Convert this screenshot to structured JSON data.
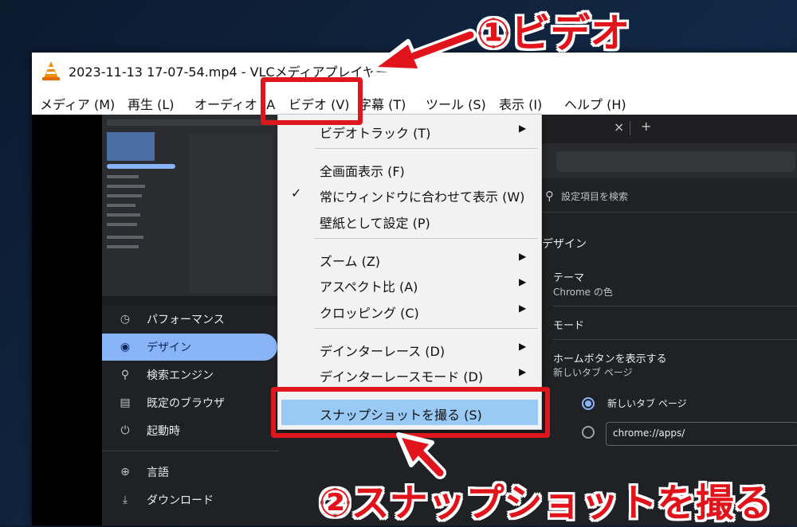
{
  "window": {
    "title": "2023-11-13 17-07-54.mp4 - VLCメディアプレイヤー"
  },
  "menubar": {
    "items": [
      "メディア (M)",
      "再生 (L)",
      "オーディオ (A",
      "ビデオ (V)",
      "字幕 (T)",
      "ツール (S)",
      "表示 (I)",
      "ヘルプ (H)"
    ]
  },
  "video_menu": {
    "items": [
      {
        "label": "ビデオトラック (T)",
        "submenu": true
      },
      {
        "label": "全画面表示 (F)"
      },
      {
        "label": "常にウィンドウに合わせて表示 (W)",
        "checked": true
      },
      {
        "label": "壁紙として設定 (P)"
      },
      {
        "label": "ズーム (Z)",
        "submenu": true
      },
      {
        "label": "アスペクト比 (A)",
        "submenu": true
      },
      {
        "label": "クロッピング (C)",
        "submenu": true
      },
      {
        "label": "デインターレース (D)",
        "submenu": true
      },
      {
        "label": "デインターレースモード (D)",
        "submenu": true
      },
      {
        "label": "スナップショットを撮る (S)",
        "highlighted": true
      }
    ],
    "check_glyph": "✓",
    "arrow_glyph": "▶"
  },
  "chrome_settings": {
    "sidebar": [
      {
        "label": "パフォーマンス",
        "icon": "speedometer-icon",
        "glyph": "◷"
      },
      {
        "label": "デザイン",
        "icon": "palette-icon",
        "glyph": "◉",
        "active": true
      },
      {
        "label": "検索エンジン",
        "icon": "search-icon",
        "glyph": "⚲"
      },
      {
        "label": "既定のブラウザ",
        "icon": "browser-icon",
        "glyph": "▤"
      },
      {
        "label": "起動時",
        "icon": "power-icon",
        "glyph": "⏻"
      },
      {
        "label": "言語",
        "icon": "globe-icon",
        "glyph": "⊕"
      },
      {
        "label": "ダウンロード",
        "icon": "download-icon",
        "glyph": "⤓"
      }
    ],
    "tab_close": "×",
    "tab_add": "+",
    "search_placeholder": "設定項目を検索",
    "section_title": "デザイン",
    "theme_label": "テーマ",
    "theme_value": "Chrome の色",
    "mode_label": "モード",
    "home_label": "ホームボタンを表示する",
    "home_sub": "新しいタブ ページ",
    "radio_new_tab": "新しいタブ ページ",
    "radio_url": "chrome://apps/"
  },
  "annotations": {
    "step1": "①ビデオ",
    "step2": "②スナップショットを撮る"
  },
  "colors": {
    "annotation_red": "#e2141b",
    "highlight_blue": "#99c9f5",
    "chrome_accent": "#8ab4f8"
  }
}
